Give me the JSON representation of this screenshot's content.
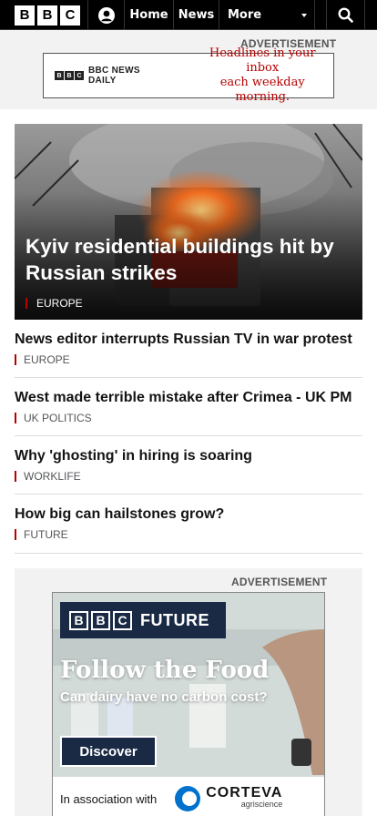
{
  "nav": {
    "logo_letters": [
      "B",
      "B",
      "C"
    ],
    "home_label": "Home",
    "news_label": "News",
    "more_label": "More"
  },
  "ad_top": {
    "label": "ADVERTISEMENT",
    "brand": "BBC NEWS DAILY",
    "brand_letters": [
      "B",
      "B",
      "C"
    ],
    "tagline_line1": "Headlines in your inbox",
    "tagline_line2": "each weekday morning."
  },
  "hero": {
    "title": "Kyiv residential buildings hit by Russian strikes",
    "tag": "EUROPE"
  },
  "stories": [
    {
      "title": "News editor interrupts Russian TV in war protest",
      "tag": "EUROPE"
    },
    {
      "title": "West made terrible mistake after Crimea - UK PM",
      "tag": "UK POLITICS"
    },
    {
      "title": "Why 'ghosting' in hiring is soaring",
      "tag": "WORKLIFE"
    },
    {
      "title": "How big can hailstones grow?",
      "tag": "FUTURE"
    }
  ],
  "ad_bottom": {
    "label": "ADVERTISEMENT",
    "bbc_letters": [
      "B",
      "B",
      "C"
    ],
    "brand": "FUTURE",
    "headline": "Follow the Food",
    "subline": "Can dairy have no carbon cost?",
    "button": "Discover",
    "association": "In association with",
    "sponsor": "CORTEVA",
    "sponsor_sub": "agriscience"
  },
  "colors": {
    "accent": "#b80000",
    "nav_bg": "#000000",
    "ad_bg": "#f2f2f2",
    "future_navy": "#1a2a45"
  }
}
